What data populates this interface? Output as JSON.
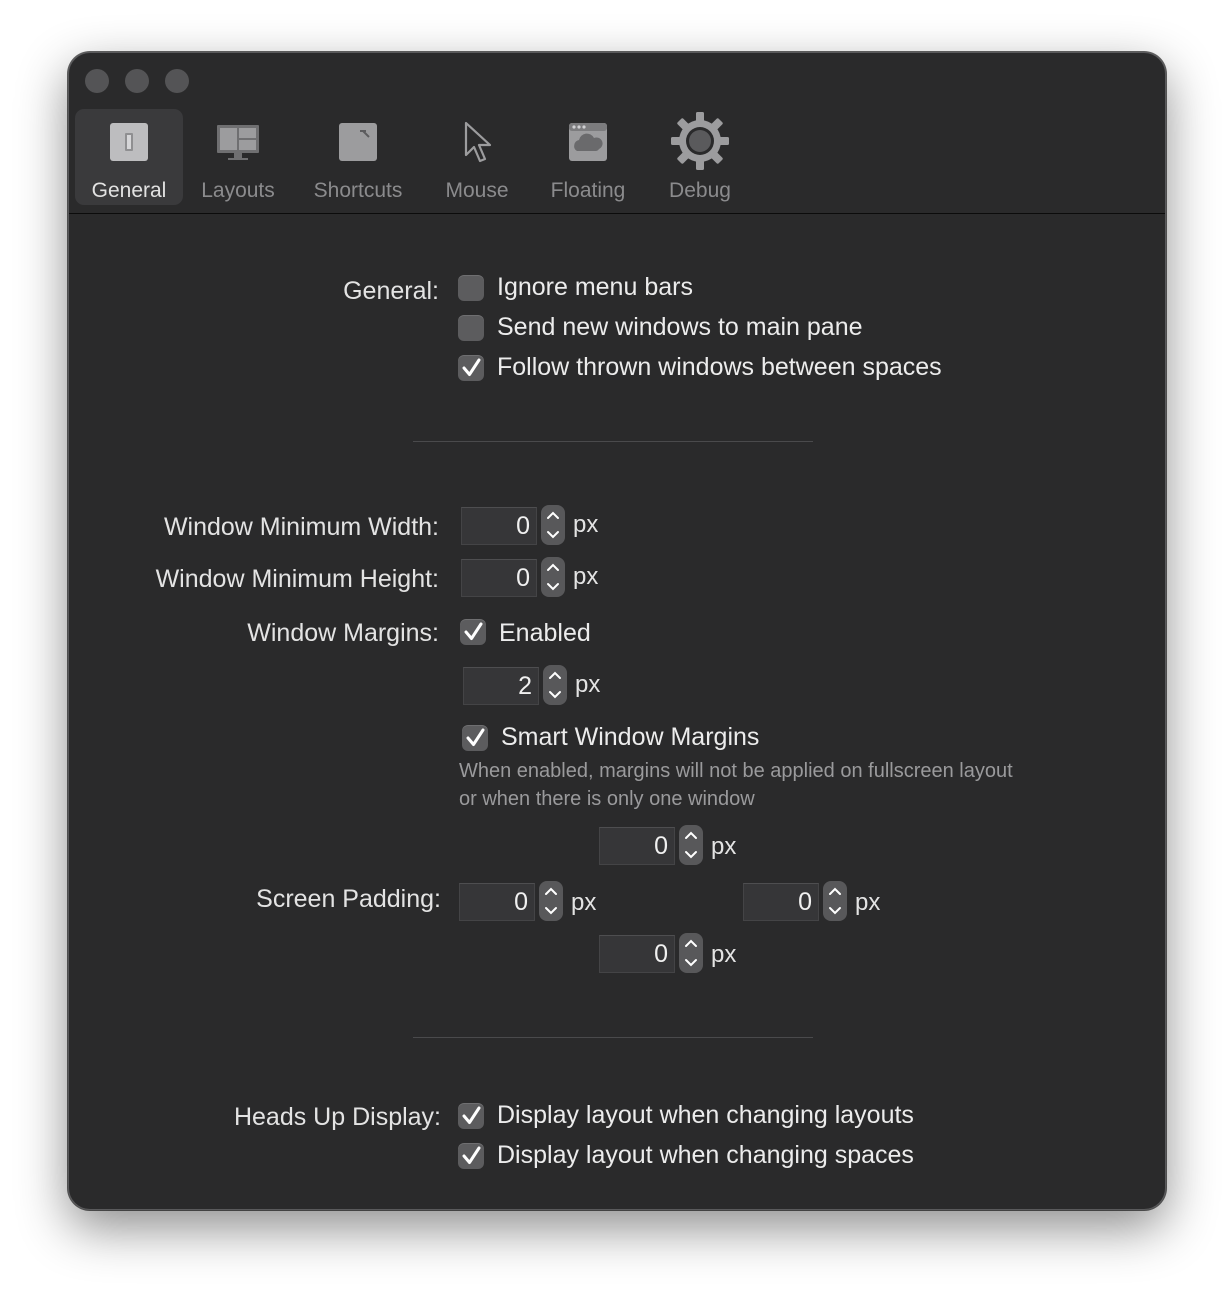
{
  "window": {
    "traffic_lights": [
      "close",
      "minimize",
      "zoom"
    ]
  },
  "toolbar": {
    "tabs": [
      {
        "label": "General",
        "icon": "switch-icon",
        "selected": true
      },
      {
        "label": "Layouts",
        "icon": "layouts-icon",
        "selected": false
      },
      {
        "label": "Shortcuts",
        "icon": "shortcuts-icon",
        "selected": false
      },
      {
        "label": "Mouse",
        "icon": "cursor-icon",
        "selected": false
      },
      {
        "label": "Floating",
        "icon": "floating-window-icon",
        "selected": false
      },
      {
        "label": "Debug",
        "icon": "gear-icon",
        "selected": false
      }
    ]
  },
  "general": {
    "label": "General:",
    "options": [
      {
        "label": "Ignore menu bars",
        "checked": false
      },
      {
        "label": "Send new windows to main pane",
        "checked": false
      },
      {
        "label": "Follow thrown windows between spaces",
        "checked": true
      }
    ]
  },
  "window_size": {
    "min_width_label": "Window Minimum Width:",
    "min_width_value": "0",
    "min_height_label": "Window Minimum Height:",
    "min_height_value": "0"
  },
  "margins": {
    "label": "Window Margins:",
    "enabled_label": "Enabled",
    "enabled_checked": true,
    "value": "2",
    "smart_label": "Smart Window Margins",
    "smart_checked": true,
    "smart_help_line1": "When enabled, margins will not be applied on fullscreen layout",
    "smart_help_line2": "or when there is only one window"
  },
  "padding": {
    "label": "Screen Padding:",
    "top": "0",
    "left": "0",
    "right": "0",
    "bottom": "0"
  },
  "unit": "px",
  "hud": {
    "label": "Heads Up Display:",
    "options": [
      {
        "label": "Display layout when changing layouts",
        "checked": true
      },
      {
        "label": "Display layout when changing spaces",
        "checked": true
      }
    ]
  },
  "colors": {
    "window_bg": "#2a2a2b",
    "selected_tab_bg": "#3a3a3c",
    "checkbox_bg": "#5c5c5e"
  }
}
